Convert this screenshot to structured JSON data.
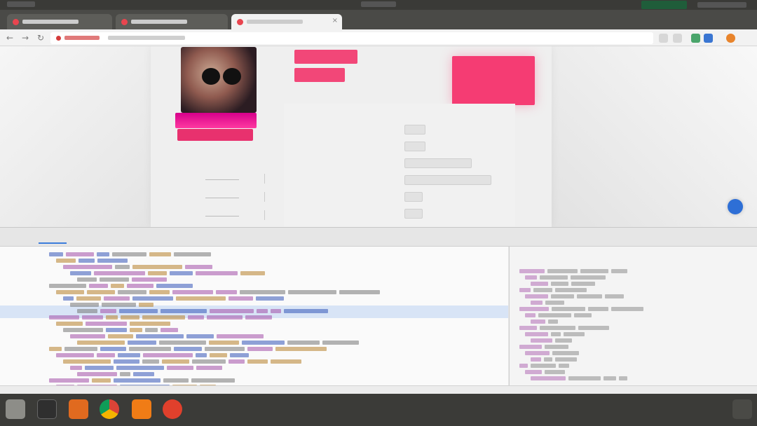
{
  "os_bar": {
    "app_label": "",
    "clock": ""
  },
  "browser": {
    "tabs": [
      {
        "title": ""
      },
      {
        "title": ""
      },
      {
        "title": ""
      }
    ],
    "address": {
      "host": "",
      "path": ""
    }
  },
  "profile": {
    "username": "",
    "photo_button_label": "",
    "stats": [
      {
        "label": "",
        "value": ""
      },
      {
        "label": "",
        "value": ""
      },
      {
        "label": "",
        "value": ""
      }
    ]
  },
  "actions": {
    "button_1": "",
    "button_2": ""
  },
  "promo": {
    "title": "",
    "subtitle": ""
  },
  "form": {
    "fields": [
      {
        "label": "",
        "value": ""
      },
      {
        "label": "",
        "value": ""
      },
      {
        "label": "",
        "value": ""
      },
      {
        "label": "",
        "value": ""
      },
      {
        "label": "",
        "value": ""
      },
      {
        "label": "",
        "value": ""
      }
    ]
  },
  "devtools": {
    "tabs": [
      "",
      "",
      "",
      "",
      "",
      "",
      "",
      "",
      ""
    ],
    "active_tab_index": 0,
    "sidebar_tabs": [
      "",
      "",
      "",
      "",
      ""
    ],
    "breadcrumb": ""
  },
  "colors": {
    "accent_pink": "#f24778",
    "promo_pink": "#f53c73",
    "photo_band_magenta": "#d6008b",
    "devtools_selection": "#d8e4f6",
    "taskbar": "#3b3b38"
  },
  "icons": {
    "back": "back-arrow-icon",
    "forward": "forward-arrow-icon",
    "reload": "reload-icon",
    "help": "chat-help-icon"
  }
}
